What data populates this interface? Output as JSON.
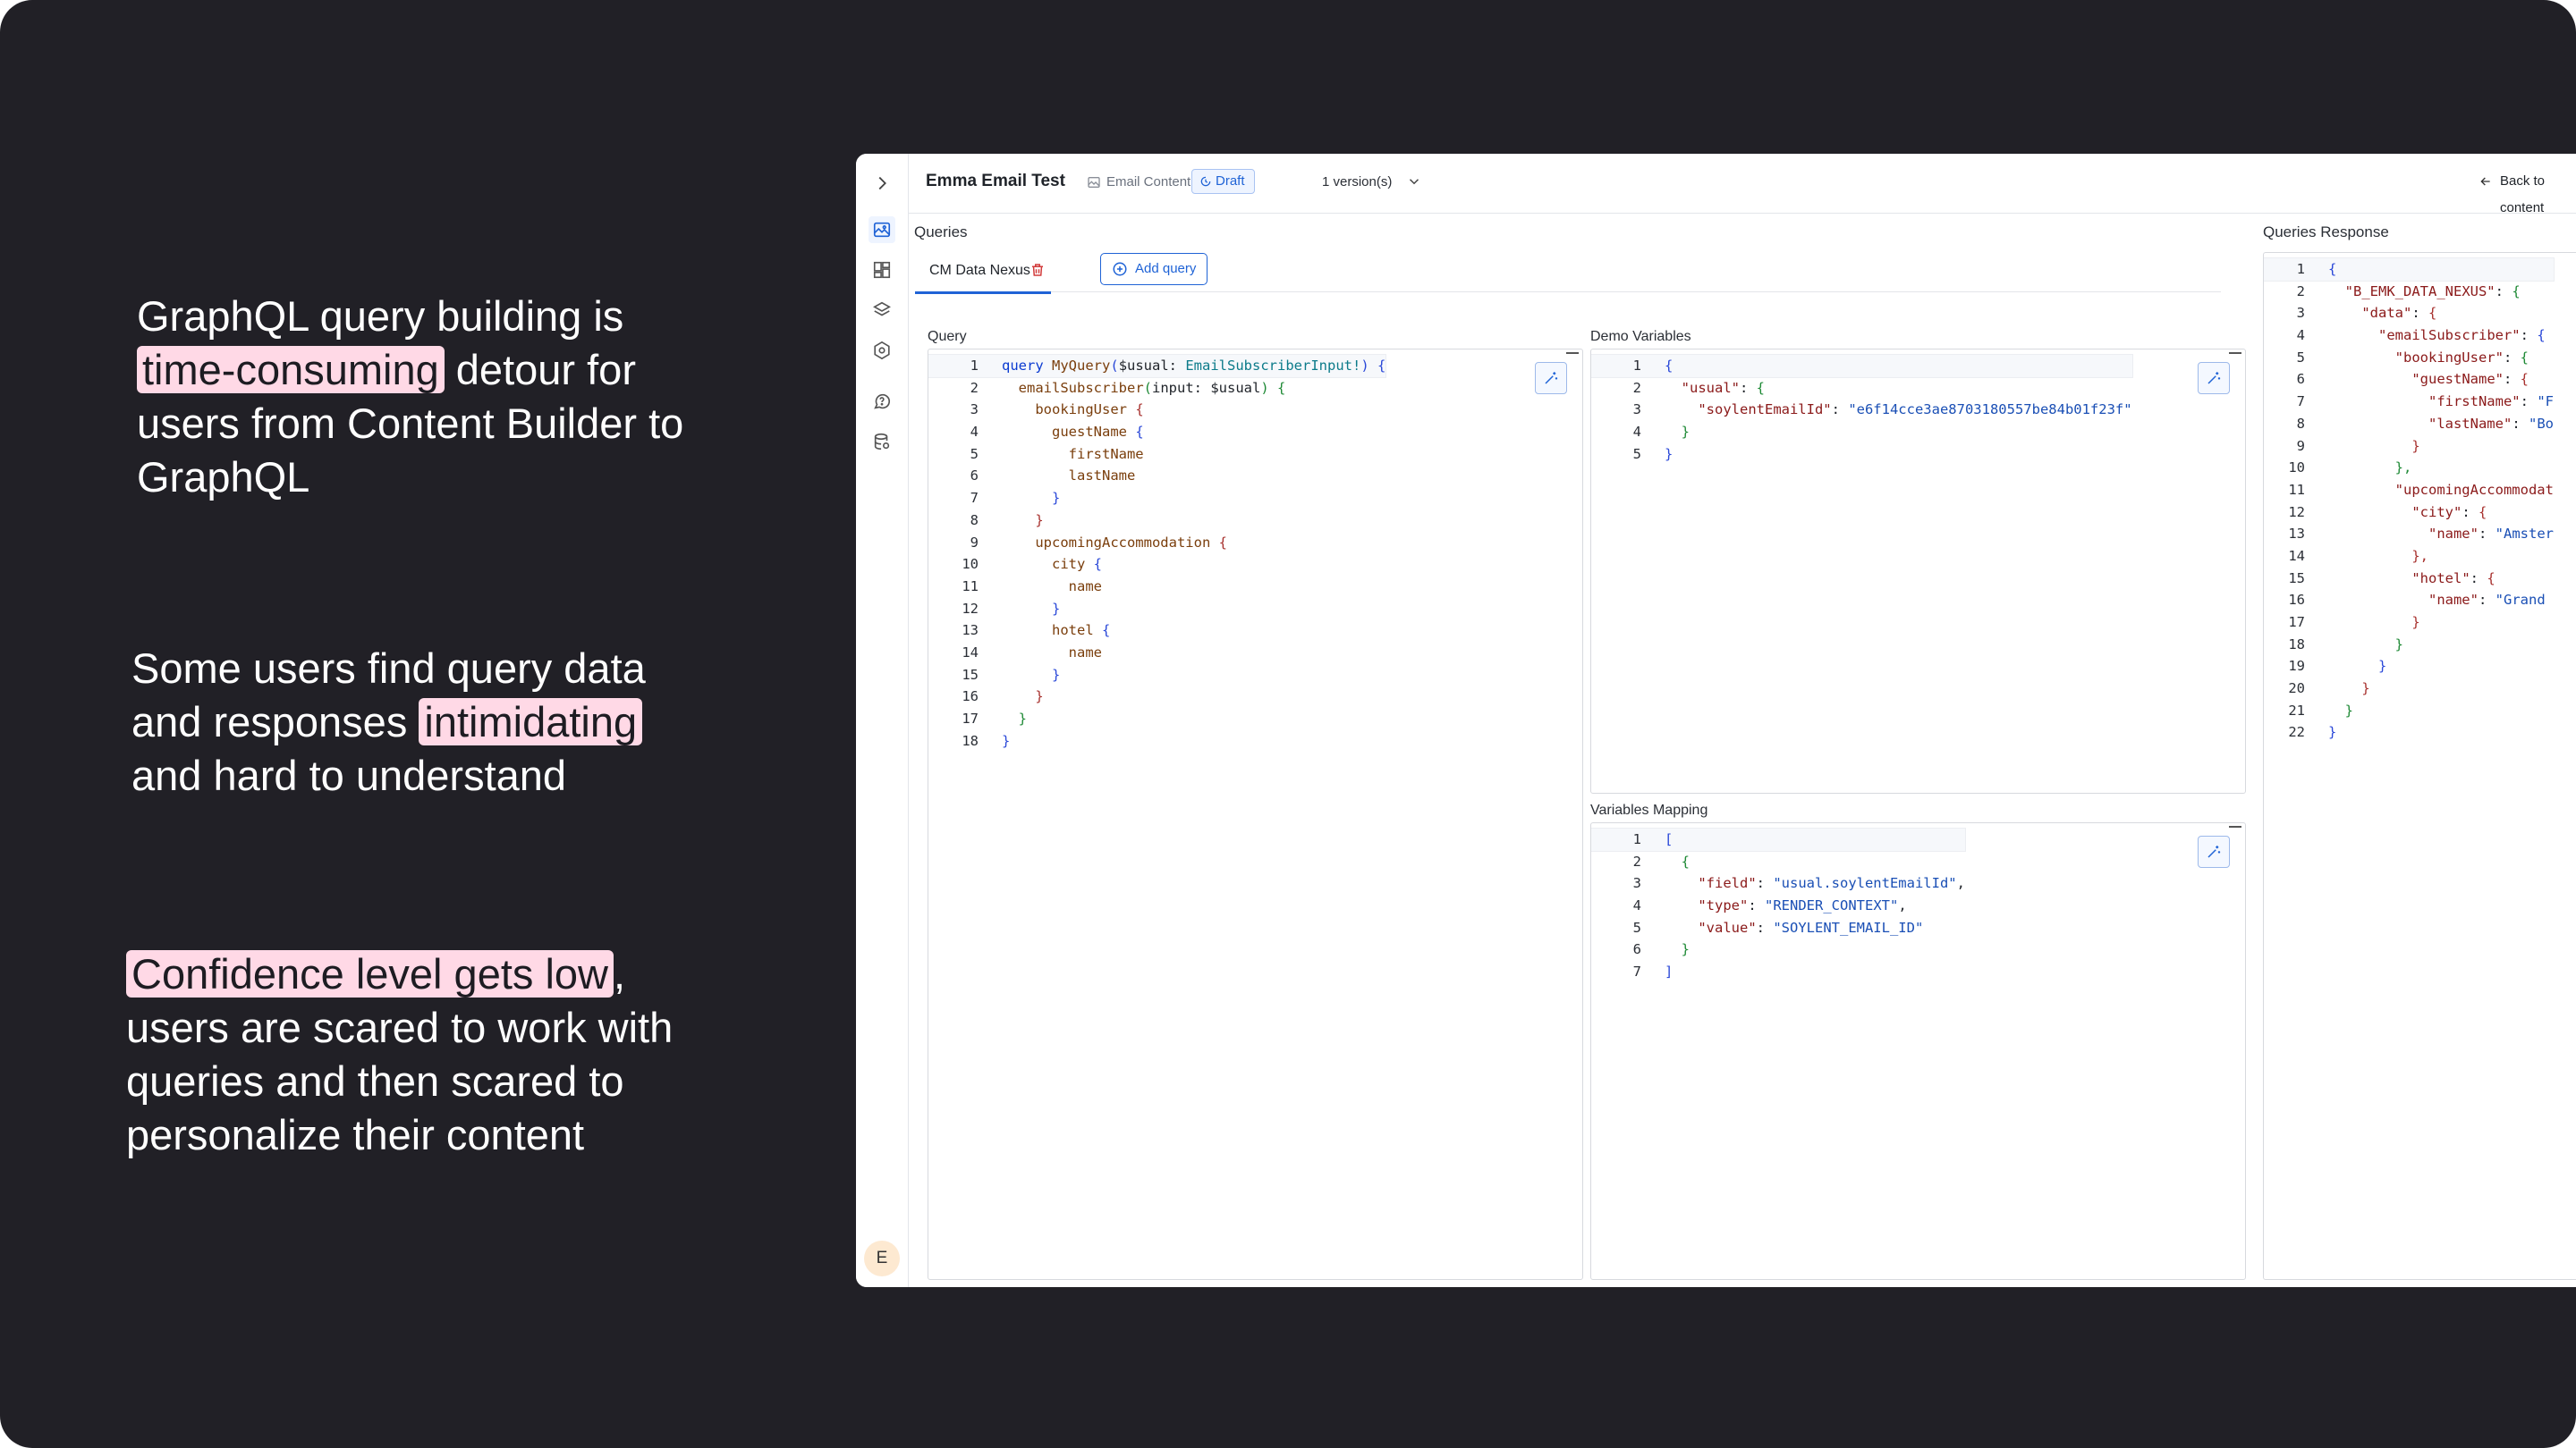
{
  "messages": {
    "m1": {
      "pre": "GraphQL query building is",
      "hl": "time-consuming",
      "post": "detour for users from Content Builder to GraphQL"
    },
    "m2": {
      "pre": "Some users find query data and responses",
      "hl": "intimidating",
      "post": "and hard to understand"
    },
    "m3": {
      "pre": "",
      "hl": "Confidence level gets low",
      "post": ", users are scared to work with queries and then scared to personalize their content"
    }
  },
  "app": {
    "title": "Emma Email Test",
    "breadcrumb": "Email Content",
    "status": "Draft",
    "versions": "1 version(s)",
    "back": "Back to content",
    "avatar": "E",
    "queries_label": "Queries",
    "response_label": "Queries Response",
    "tab": "CM Data Nexus",
    "add_query": "Add query",
    "query_label": "Query",
    "demo_label": "Demo Variables",
    "mapping_label": "Variables Mapping"
  },
  "icons": {
    "rail": [
      "chevron-right-icon",
      "image-icon",
      "layout-icon",
      "layers-icon",
      "graphql-icon",
      "help-icon",
      "database-icon"
    ],
    "format": "magic-format-icon",
    "trash": "trash-icon",
    "add": "plus-circle-icon"
  },
  "colors": {
    "accent": "#1f63d6",
    "highlight": "#ffd9e6",
    "slide_bg": "#212026"
  },
  "editors": {
    "query": {
      "rows": [
        [
          [
            "kw",
            "query"
          ],
          [
            "op",
            " "
          ],
          [
            "fn",
            "MyQuery"
          ],
          [
            "b1",
            "("
          ],
          [
            "vr",
            "$usual: "
          ],
          [
            "tp",
            "EmailSubscriberInput!"
          ],
          [
            "b1",
            ")"
          ],
          [
            "op",
            " "
          ],
          [
            "b1",
            "{"
          ]
        ],
        [
          [
            "op",
            "  "
          ],
          [
            "fn",
            "emailSubscriber"
          ],
          [
            "b2",
            "("
          ],
          [
            "vr",
            "input: $usual"
          ],
          [
            "b2",
            ")"
          ],
          [
            "op",
            " "
          ],
          [
            "b2",
            "{"
          ]
        ],
        [
          [
            "op",
            "    "
          ],
          [
            "pr",
            "bookingUser"
          ],
          [
            "op",
            " "
          ],
          [
            "b3",
            "{"
          ]
        ],
        [
          [
            "op",
            "      "
          ],
          [
            "pr",
            "guestName"
          ],
          [
            "op",
            " "
          ],
          [
            "b1",
            "{"
          ]
        ],
        [
          [
            "op",
            "        "
          ],
          [
            "pr",
            "firstName"
          ]
        ],
        [
          [
            "op",
            "        "
          ],
          [
            "pr",
            "lastName"
          ]
        ],
        [
          [
            "op",
            "      "
          ],
          [
            "b1",
            "}"
          ]
        ],
        [
          [
            "op",
            "    "
          ],
          [
            "b3",
            "}"
          ]
        ],
        [
          [
            "op",
            "    "
          ],
          [
            "pr",
            "upcomingAccommodation"
          ],
          [
            "op",
            " "
          ],
          [
            "b3",
            "{"
          ]
        ],
        [
          [
            "op",
            "      "
          ],
          [
            "pr",
            "city"
          ],
          [
            "op",
            " "
          ],
          [
            "b1",
            "{"
          ]
        ],
        [
          [
            "op",
            "        "
          ],
          [
            "pr",
            "name"
          ]
        ],
        [
          [
            "op",
            "      "
          ],
          [
            "b1",
            "}"
          ]
        ],
        [
          [
            "op",
            "      "
          ],
          [
            "pr",
            "hotel"
          ],
          [
            "op",
            " "
          ],
          [
            "b1",
            "{"
          ]
        ],
        [
          [
            "op",
            "        "
          ],
          [
            "pr",
            "name"
          ]
        ],
        [
          [
            "op",
            "      "
          ],
          [
            "b1",
            "}"
          ]
        ],
        [
          [
            "op",
            "    "
          ],
          [
            "b3",
            "}"
          ]
        ],
        [
          [
            "op",
            "  "
          ],
          [
            "b2",
            "}"
          ]
        ],
        [
          [
            "b1",
            "}"
          ]
        ]
      ]
    },
    "demo": {
      "rows": [
        [
          [
            "b1",
            "{"
          ]
        ],
        [
          [
            "op",
            "  "
          ],
          [
            "key",
            "\"usual\""
          ],
          [
            "op",
            ": "
          ],
          [
            "b2",
            "{"
          ]
        ],
        [
          [
            "op",
            "    "
          ],
          [
            "key",
            "\"soylentEmailId\""
          ],
          [
            "op",
            ": "
          ],
          [
            "str",
            "\"e6f14cce3ae8703180557be84b01f23f\""
          ]
        ],
        [
          [
            "op",
            "  "
          ],
          [
            "b2",
            "}"
          ]
        ],
        [
          [
            "b1",
            "}"
          ]
        ]
      ]
    },
    "mapping": {
      "rows": [
        [
          [
            "b1",
            "["
          ]
        ],
        [
          [
            "op",
            "  "
          ],
          [
            "b2",
            "{"
          ]
        ],
        [
          [
            "op",
            "    "
          ],
          [
            "key",
            "\"field\""
          ],
          [
            "op",
            ": "
          ],
          [
            "str",
            "\"usual.soylentEmailId\""
          ],
          [
            "op",
            ","
          ]
        ],
        [
          [
            "op",
            "    "
          ],
          [
            "key",
            "\"type\""
          ],
          [
            "op",
            ": "
          ],
          [
            "str",
            "\"RENDER_CONTEXT\""
          ],
          [
            "op",
            ","
          ]
        ],
        [
          [
            "op",
            "    "
          ],
          [
            "key",
            "\"value\""
          ],
          [
            "op",
            ": "
          ],
          [
            "str",
            "\"SOYLENT_EMAIL_ID\""
          ]
        ],
        [
          [
            "op",
            "  "
          ],
          [
            "b2",
            "}"
          ]
        ],
        [
          [
            "b1",
            "]"
          ]
        ]
      ]
    },
    "response": {
      "rows": [
        [
          [
            "b1",
            "{"
          ]
        ],
        [
          [
            "op",
            "  "
          ],
          [
            "key",
            "\"B_EMK_DATA_NEXUS\""
          ],
          [
            "op",
            ": "
          ],
          [
            "b2",
            "{"
          ]
        ],
        [
          [
            "op",
            "    "
          ],
          [
            "key",
            "\"data\""
          ],
          [
            "op",
            ": "
          ],
          [
            "b3",
            "{"
          ]
        ],
        [
          [
            "op",
            "      "
          ],
          [
            "key",
            "\"emailSubscriber\""
          ],
          [
            "op",
            ": "
          ],
          [
            "b1",
            "{"
          ]
        ],
        [
          [
            "op",
            "        "
          ],
          [
            "key",
            "\"bookingUser\""
          ],
          [
            "op",
            ": "
          ],
          [
            "b2",
            "{"
          ]
        ],
        [
          [
            "op",
            "          "
          ],
          [
            "key",
            "\"guestName\""
          ],
          [
            "op",
            ": "
          ],
          [
            "b3",
            "{"
          ]
        ],
        [
          [
            "op",
            "            "
          ],
          [
            "key",
            "\"firstName\""
          ],
          [
            "op",
            ": "
          ],
          [
            "str",
            "\"F"
          ]
        ],
        [
          [
            "op",
            "            "
          ],
          [
            "key",
            "\"lastName\""
          ],
          [
            "op",
            ": "
          ],
          [
            "str",
            "\"Bo"
          ]
        ],
        [
          [
            "op",
            "          "
          ],
          [
            "b3",
            "}"
          ]
        ],
        [
          [
            "op",
            "        "
          ],
          [
            "b2",
            "},"
          ]
        ],
        [
          [
            "op",
            "        "
          ],
          [
            "key",
            "\"upcomingAccommodat"
          ]
        ],
        [
          [
            "op",
            "          "
          ],
          [
            "key",
            "\"city\""
          ],
          [
            "op",
            ": "
          ],
          [
            "b3",
            "{"
          ]
        ],
        [
          [
            "op",
            "            "
          ],
          [
            "key",
            "\"name\""
          ],
          [
            "op",
            ": "
          ],
          [
            "str",
            "\"Amster"
          ]
        ],
        [
          [
            "op",
            "          "
          ],
          [
            "b3",
            "},"
          ]
        ],
        [
          [
            "op",
            "          "
          ],
          [
            "key",
            "\"hotel\""
          ],
          [
            "op",
            ": "
          ],
          [
            "b3",
            "{"
          ]
        ],
        [
          [
            "op",
            "            "
          ],
          [
            "key",
            "\"name\""
          ],
          [
            "op",
            ": "
          ],
          [
            "str",
            "\"Grand"
          ]
        ],
        [
          [
            "op",
            "          "
          ],
          [
            "b3",
            "}"
          ]
        ],
        [
          [
            "op",
            "        "
          ],
          [
            "b2",
            "}"
          ]
        ],
        [
          [
            "op",
            "      "
          ],
          [
            "b1",
            "}"
          ]
        ],
        [
          [
            "op",
            "    "
          ],
          [
            "b3",
            "}"
          ]
        ],
        [
          [
            "op",
            "  "
          ],
          [
            "b2",
            "}"
          ]
        ],
        [
          [
            "b1",
            "}"
          ]
        ]
      ]
    }
  }
}
